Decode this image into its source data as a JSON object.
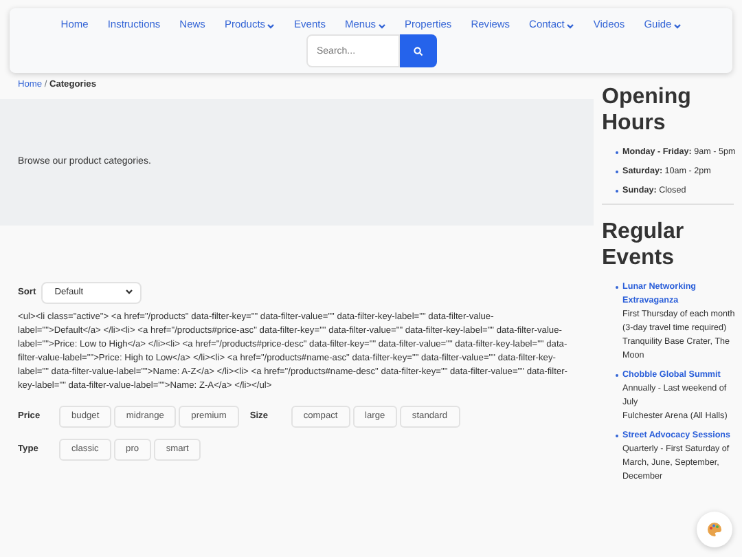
{
  "nav": {
    "items": [
      {
        "label": "Home",
        "dropdown": false
      },
      {
        "label": "Instructions",
        "dropdown": false
      },
      {
        "label": "News",
        "dropdown": false
      },
      {
        "label": "Products",
        "dropdown": true
      },
      {
        "label": "Events",
        "dropdown": false
      },
      {
        "label": "Menus",
        "dropdown": true
      },
      {
        "label": "Properties",
        "dropdown": false
      },
      {
        "label": "Reviews",
        "dropdown": false
      },
      {
        "label": "Contact",
        "dropdown": true
      },
      {
        "label": "Videos",
        "dropdown": false
      },
      {
        "label": "Guide",
        "dropdown": true
      }
    ],
    "search": {
      "placeholder": "Search..."
    }
  },
  "breadcrumb_separator": "/",
  "breadcrumb": [
    {
      "label": "Home",
      "current": false
    },
    {
      "label": "Categories",
      "current": true
    }
  ],
  "intro": "Browse our product categories.",
  "sort": {
    "label": "Sort",
    "value": "Default",
    "markup": "<ul><li class=\"active\"> <a href=\"/products\" data-filter-key=\"\" data-filter-value=\"\" data-filter-key-label=\"\" data-filter-value-label=\"\">Default</a> </li><li> <a href=\"/products#price-asc\" data-filter-key=\"\" data-filter-value=\"\" data-filter-key-label=\"\" data-filter-value-label=\"\">Price: Low to High</a> </li><li> <a href=\"/products#price-desc\" data-filter-key=\"\" data-filter-value=\"\" data-filter-key-label=\"\" data-filter-value-label=\"\">Price: High to Low</a> </li><li> <a href=\"/products#name-asc\" data-filter-key=\"\" data-filter-value=\"\" data-filter-key-label=\"\" data-filter-value-label=\"\">Name: A-Z</a> </li><li> <a href=\"/products#name-desc\" data-filter-key=\"\" data-filter-value=\"\" data-filter-key-label=\"\" data-filter-value-label=\"\">Name: Z-A</a> </li></ul>"
  },
  "filter_rows": [
    [
      {
        "label": "Price",
        "options": [
          "budget",
          "midrange",
          "premium"
        ]
      },
      {
        "label": "Size",
        "options": [
          "compact",
          "large",
          "standard"
        ]
      }
    ],
    [
      {
        "label": "Type",
        "options": [
          "classic",
          "pro",
          "smart"
        ]
      }
    ]
  ],
  "opening_hours": {
    "title": "Opening Hours",
    "items": [
      {
        "day": "Monday - Friday:",
        "time": "9am - 5pm"
      },
      {
        "day": "Saturday:",
        "time": "10am - 2pm"
      },
      {
        "day": "Sunday:",
        "time": "Closed"
      }
    ]
  },
  "events": {
    "title": "Regular Events",
    "items": [
      {
        "name": "Lunar Networking Extravaganza",
        "lines": [
          "First Thursday of each month (3-day travel time required)",
          "Tranquility Base Crater, The Moon"
        ]
      },
      {
        "name": "Chobble Global Summit",
        "lines": [
          "Annually - Last weekend of July",
          "Fulchester Arena (All Halls)"
        ]
      },
      {
        "name": "Street Advocacy Sessions",
        "lines": [
          "Quarterly - First Saturday of March, June, September, December"
        ]
      }
    ]
  }
}
